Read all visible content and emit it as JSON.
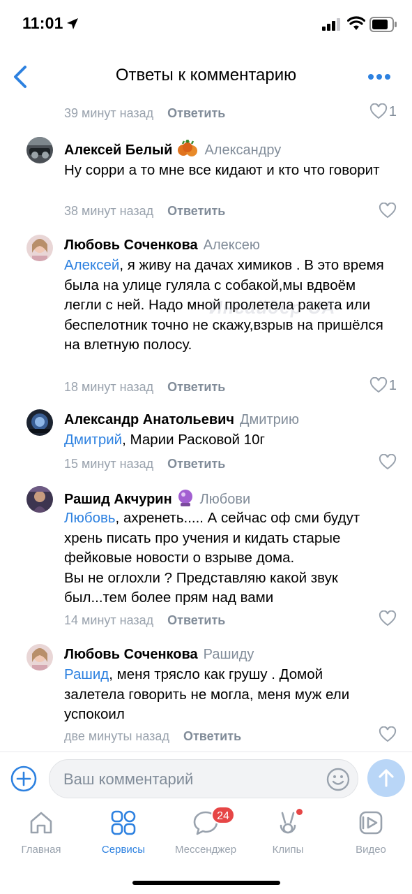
{
  "status_bar": {
    "time": "11:01"
  },
  "header": {
    "title": "Ответы к комментарию"
  },
  "watermark": "Инсайдер UA",
  "comments": [
    {
      "time": "39 минут назад",
      "reply_label": "Ответить",
      "likes": "1"
    },
    {
      "author": "Алексей Белый",
      "reply_to": "Александру",
      "text": "Ну сорри а то мне все кидают и кто что говорит",
      "time": "38 минут назад",
      "reply_label": "Ответить",
      "likes": ""
    },
    {
      "author": "Любовь Соченкова",
      "reply_to": "Алексею",
      "mention": "Алексей",
      "text": ", я живу на дачах химиков . В это время была на улице гуляла с собакой,мы вдвоём легли с ней. Надо мной пролетела ракета или беспелотник точно не скажу,взрыв на пришёлся на влетную полосу.",
      "time": "18 минут назад",
      "reply_label": "Ответить",
      "likes": "1"
    },
    {
      "author": "Александр Анатольевич",
      "reply_to": "Дмитрию",
      "mention": "Дмитрий",
      "text": ", Марии Расковой 10г",
      "time": "15 минут назад",
      "reply_label": "Ответить",
      "likes": ""
    },
    {
      "author": "Рашид Акчурин",
      "reply_to": "Любови",
      "mention": "Любовь",
      "text": ", ахренеть..... А сейчас оф сми будут хрень писать про учения и кидать старые фейковые новости о взрыве дома.\nВы не оглохли ? Представляю какой звук был...тем более прям над вами",
      "time": "14 минут назад",
      "reply_label": "Ответить",
      "likes": ""
    },
    {
      "author": "Любовь Соченкова",
      "reply_to": "Рашиду",
      "mention": "Рашид",
      "text": ", меня трясло как грушу . Домой залетела говорить не могла, меня муж ели успокоил",
      "time": "две минуты назад",
      "reply_label": "Ответить",
      "likes": ""
    }
  ],
  "input": {
    "placeholder": "Ваш комментарий"
  },
  "nav": [
    {
      "label": "Главная",
      "icon": "home-icon"
    },
    {
      "label": "Сервисы",
      "icon": "services-icon"
    },
    {
      "label": "Мессенджер",
      "icon": "messenger-icon",
      "badge": "24"
    },
    {
      "label": "Клипы",
      "icon": "clips-icon"
    },
    {
      "label": "Видео",
      "icon": "video-icon"
    }
  ],
  "colors": {
    "accent": "#2d81e0",
    "secondary": "#818c99",
    "badge": "#e64646"
  }
}
